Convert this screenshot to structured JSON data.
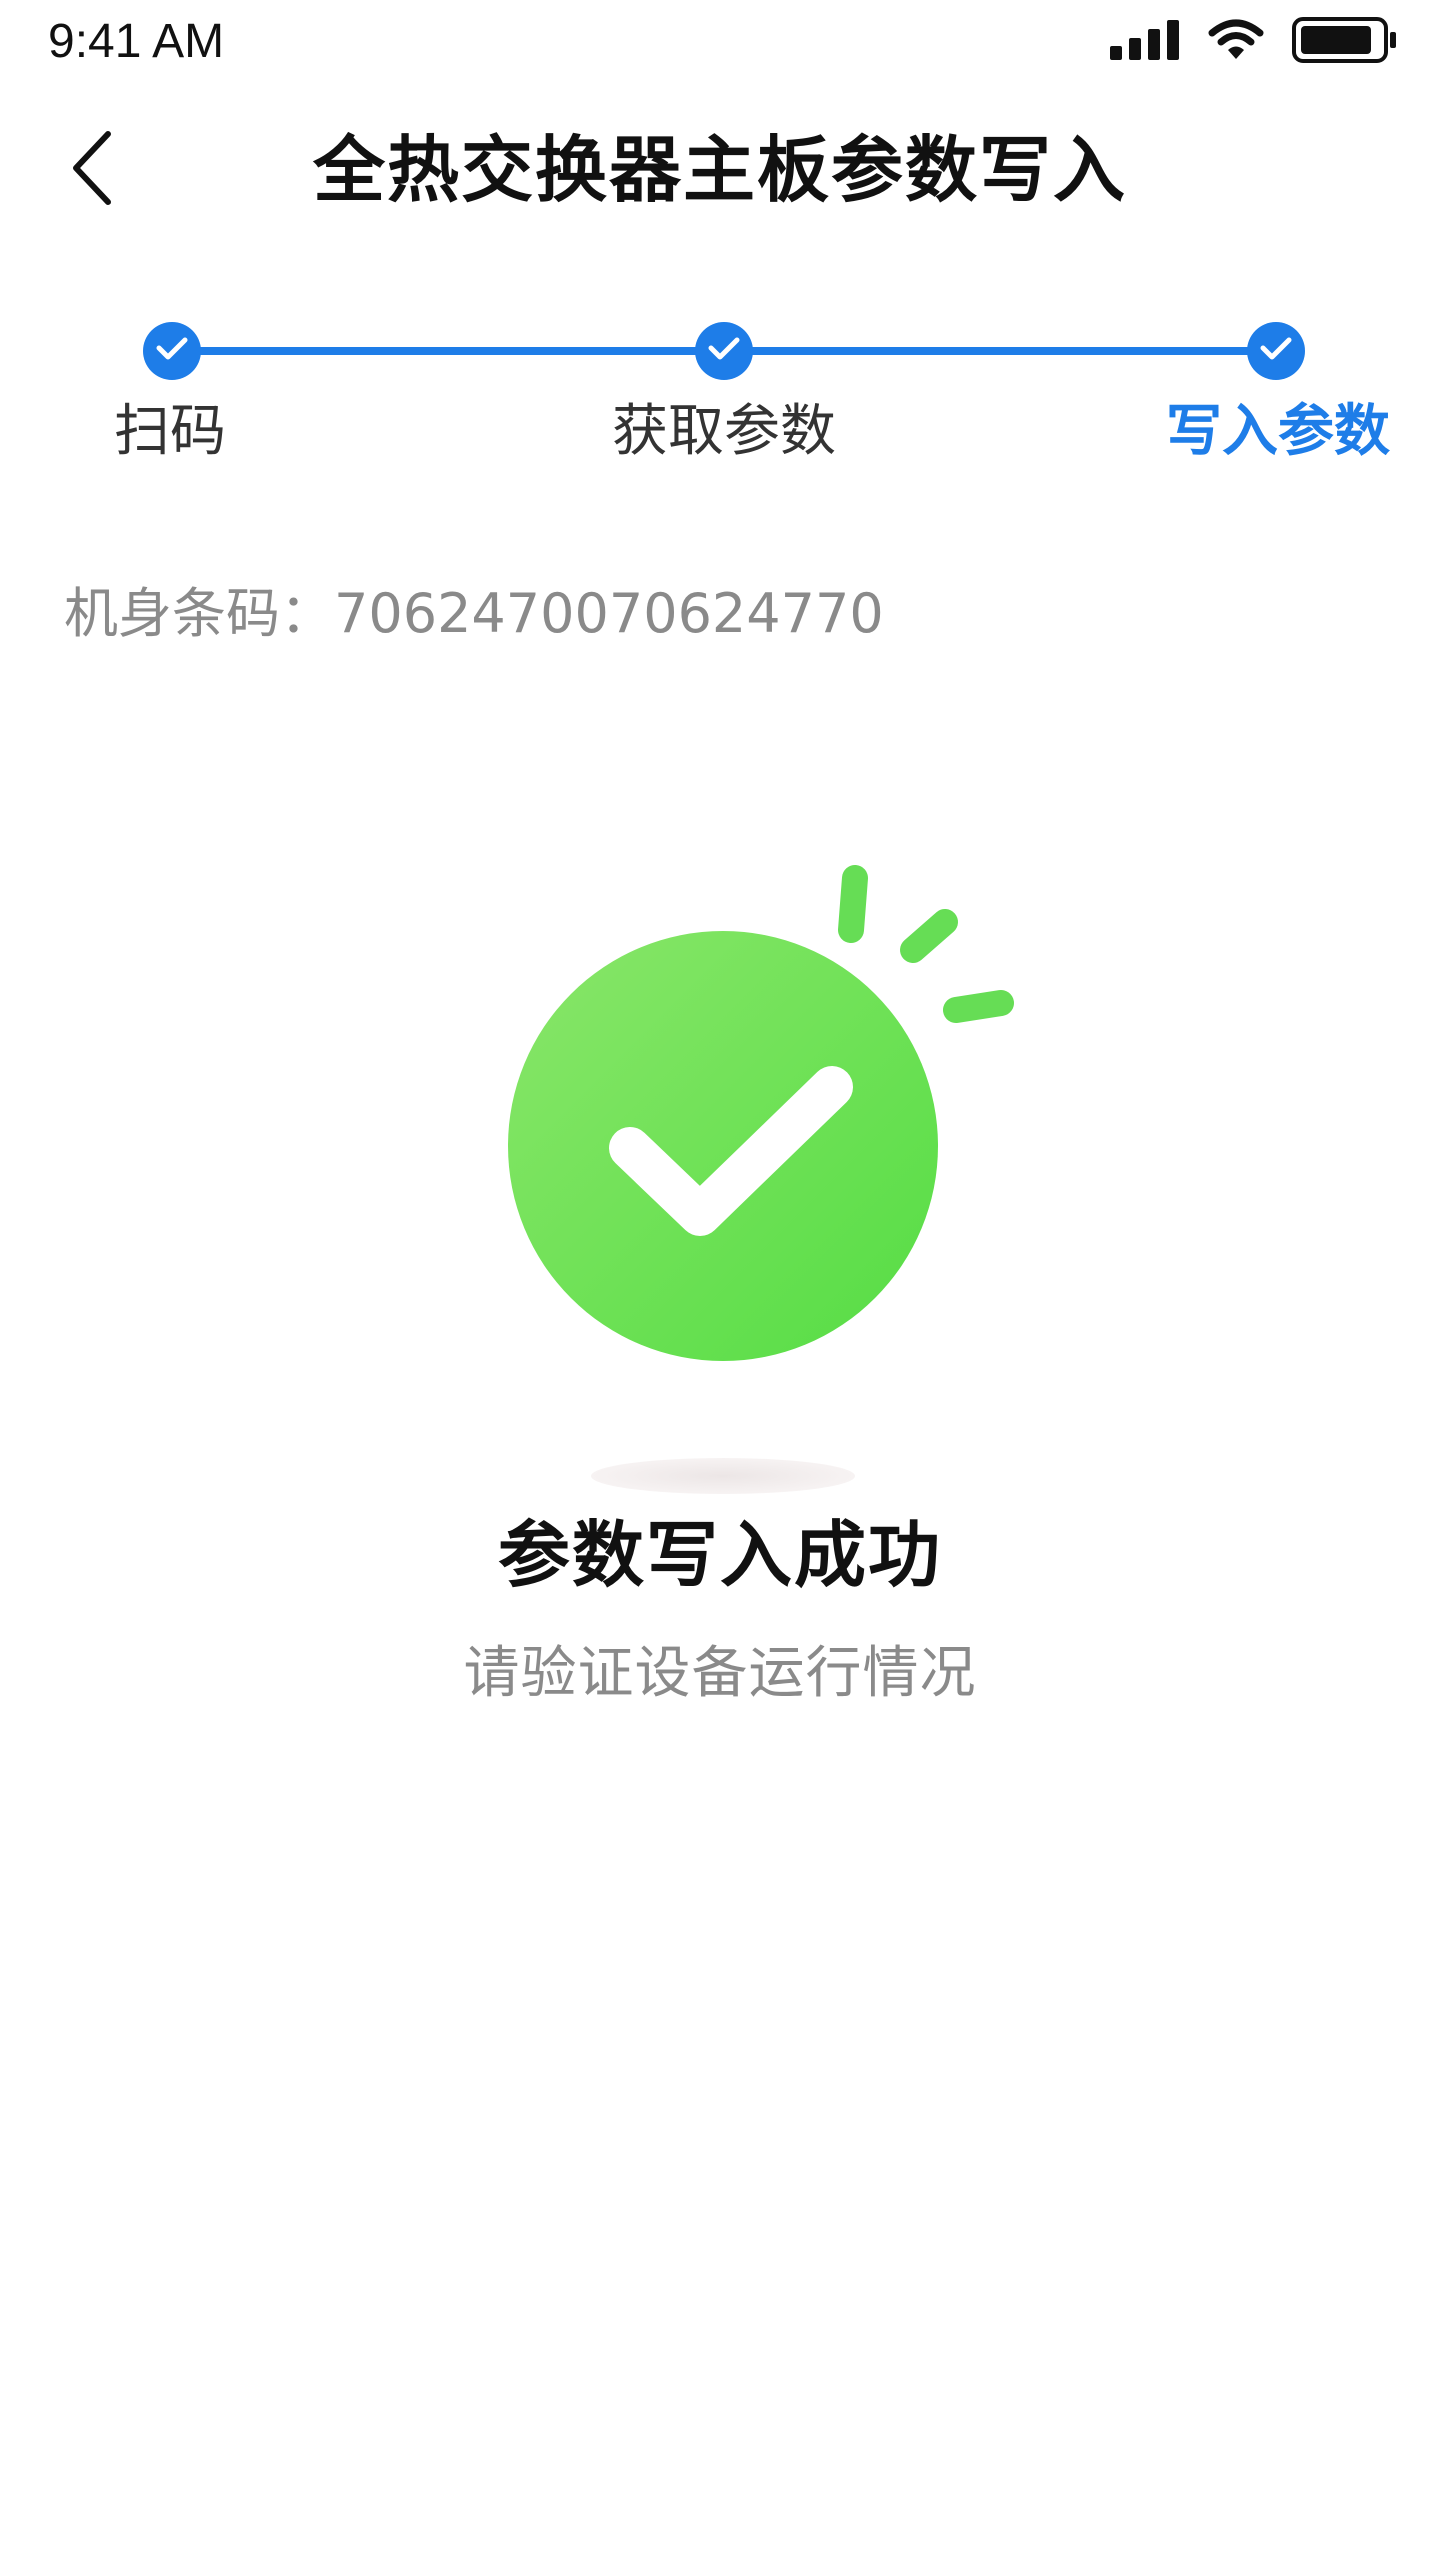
{
  "status_bar": {
    "time": "9:41 AM",
    "icons": [
      "signal-icon",
      "wifi-icon",
      "battery-icon"
    ]
  },
  "header": {
    "title": "全热交换器主板参数写入",
    "back_icon": "chevron-left-icon"
  },
  "stepper": {
    "steps": [
      {
        "label": "扫码",
        "state": "done"
      },
      {
        "label": "获取参数",
        "state": "done"
      },
      {
        "label": "写入参数",
        "state": "active"
      }
    ],
    "colors": {
      "accent": "#1e7de8",
      "inactive_text": "#333333"
    }
  },
  "serial": {
    "text": "机身条码：7062470070624770"
  },
  "result": {
    "icon": "success-check-icon",
    "title": "参数写入成功",
    "subtitle": "请验证设备运行情况",
    "colors": {
      "success": "#66dd55"
    }
  }
}
